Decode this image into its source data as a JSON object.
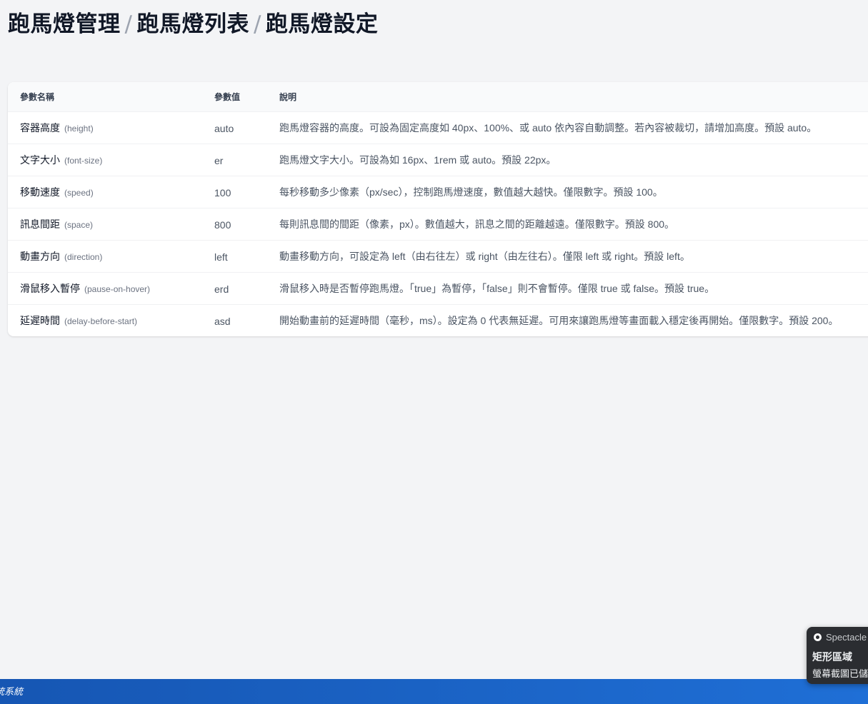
{
  "breadcrumb": {
    "items": [
      "跑馬燈管理",
      "跑馬燈列表",
      "跑馬燈設定"
    ],
    "separator": "/"
  },
  "table": {
    "headers": {
      "name": "參數名稱",
      "value": "參數值",
      "desc": "說明"
    },
    "rows": [
      {
        "name": "容器高度",
        "key": "(height)",
        "value": "auto",
        "desc": "跑馬燈容器的高度。可設為固定高度如 40px、100%、或 auto 依內容自動調整。若內容被裁切，請增加高度。預設 auto。"
      },
      {
        "name": "文字大小",
        "key": "(font-size)",
        "value": "er",
        "desc": "跑馬燈文字大小。可設為如 16px、1rem 或 auto。預設 22px。"
      },
      {
        "name": "移動速度",
        "key": "(speed)",
        "value": "100",
        "desc": "每秒移動多少像素（px/sec），控制跑馬燈速度，數值越大越快。僅限數字。預設 100。"
      },
      {
        "name": "訊息間距",
        "key": "(space)",
        "value": "800",
        "desc": "每則訊息間的間距（像素，px）。數值越大，訊息之間的距離越遠。僅限數字。預設 800。"
      },
      {
        "name": "動畫方向",
        "key": "(direction)",
        "value": "left",
        "desc": "動畫移動方向，可設定為 left（由右往左）或 right（由左往右）。僅限 left 或 right。預設 left。"
      },
      {
        "name": "滑鼠移入暫停",
        "key": "(pause-on-hover)",
        "value": "erd",
        "desc": "滑鼠移入時是否暫停跑馬燈。「true」為暫停，「false」則不會暫停。僅限 true 或 false。預設 true。"
      },
      {
        "name": "延遲時間",
        "key": "(delay-before-start)",
        "value": "asd",
        "desc": "開始動畫前的延遲時間（毫秒，ms）。設定為 0 代表無延遲。可用來讓跑馬燈等畫面載入穩定後再開始。僅限數字。預設 200。"
      }
    ]
  },
  "footer": {
    "text": "統系統"
  },
  "notification": {
    "app": "Spectacle",
    "title": "矩形區域",
    "body": "螢幕截圖已儲"
  },
  "colors": {
    "footer_bg": "#1a62c4",
    "page_bg": "#f3f4f6"
  }
}
